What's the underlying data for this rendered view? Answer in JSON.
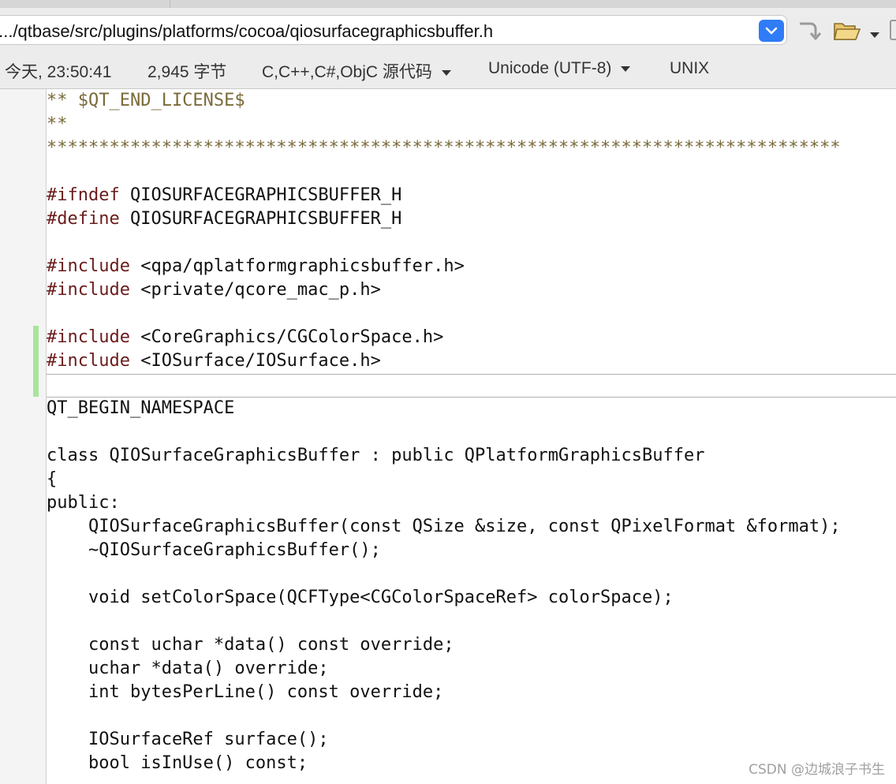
{
  "path_bar": {
    "path": "/.../qtbase/src/plugins/platforms/cocoa/qiosurfacegraphicsbuffer.h"
  },
  "status_bar": {
    "modified": "今天, 23:50:41",
    "size": "2,945 字节",
    "language": "C,C++,C#,ObjC 源代码",
    "encoding": "Unicode (UTF-8)",
    "line_endings": "UNIX"
  },
  "editor": {
    "lines": [
      {
        "text": "** $QT_END_LICENSE$",
        "kind": "comment"
      },
      {
        "text": "**",
        "kind": "comment"
      },
      {
        "text": "****************************************************************************",
        "kind": "comment"
      },
      {
        "text": "",
        "kind": "plain"
      },
      {
        "text": "#ifndef QIOSURFACEGRAPHICSBUFFER_H",
        "kind": "pp"
      },
      {
        "text": "#define QIOSURFACEGRAPHICSBUFFER_H",
        "kind": "pp"
      },
      {
        "text": "",
        "kind": "plain"
      },
      {
        "text": "#include <qpa/qplatformgraphicsbuffer.h>",
        "kind": "pp"
      },
      {
        "text": "#include <private/qcore_mac_p.h>",
        "kind": "pp"
      },
      {
        "text": "",
        "kind": "plain"
      },
      {
        "text": "#include <CoreGraphics/CGColorSpace.h>",
        "kind": "pp"
      },
      {
        "text": "#include <IOSurface/IOSurface.h>",
        "kind": "pp"
      },
      {
        "text": "",
        "kind": "plain"
      },
      {
        "text": "QT_BEGIN_NAMESPACE",
        "kind": "plain"
      },
      {
        "text": "",
        "kind": "plain"
      },
      {
        "text": "class QIOSurfaceGraphicsBuffer : public QPlatformGraphicsBuffer",
        "kind": "plain"
      },
      {
        "text": "{",
        "kind": "plain"
      },
      {
        "text": "public:",
        "kind": "plain"
      },
      {
        "text": "    QIOSurfaceGraphicsBuffer(const QSize &size, const QPixelFormat &format);",
        "kind": "plain"
      },
      {
        "text": "    ~QIOSurfaceGraphicsBuffer();",
        "kind": "plain"
      },
      {
        "text": "",
        "kind": "plain"
      },
      {
        "text": "    void setColorSpace(QCFType<CGColorSpaceRef> colorSpace);",
        "kind": "plain"
      },
      {
        "text": "",
        "kind": "plain"
      },
      {
        "text": "    const uchar *data() const override;",
        "kind": "plain"
      },
      {
        "text": "    uchar *data() override;",
        "kind": "plain"
      },
      {
        "text": "    int bytesPerLine() const override;",
        "kind": "plain"
      },
      {
        "text": "",
        "kind": "plain"
      },
      {
        "text": "    IOSurfaceRef surface();",
        "kind": "plain"
      },
      {
        "text": "    bool isInUse() const;",
        "kind": "plain"
      }
    ]
  },
  "watermark": "CSDN @边城浪子书生",
  "colors": {
    "comment": "#7a6a3a",
    "preprocessor": "#6b1c1c",
    "change_marker": "#a8e59a",
    "dropdown_accent": "#2f7cf6"
  }
}
